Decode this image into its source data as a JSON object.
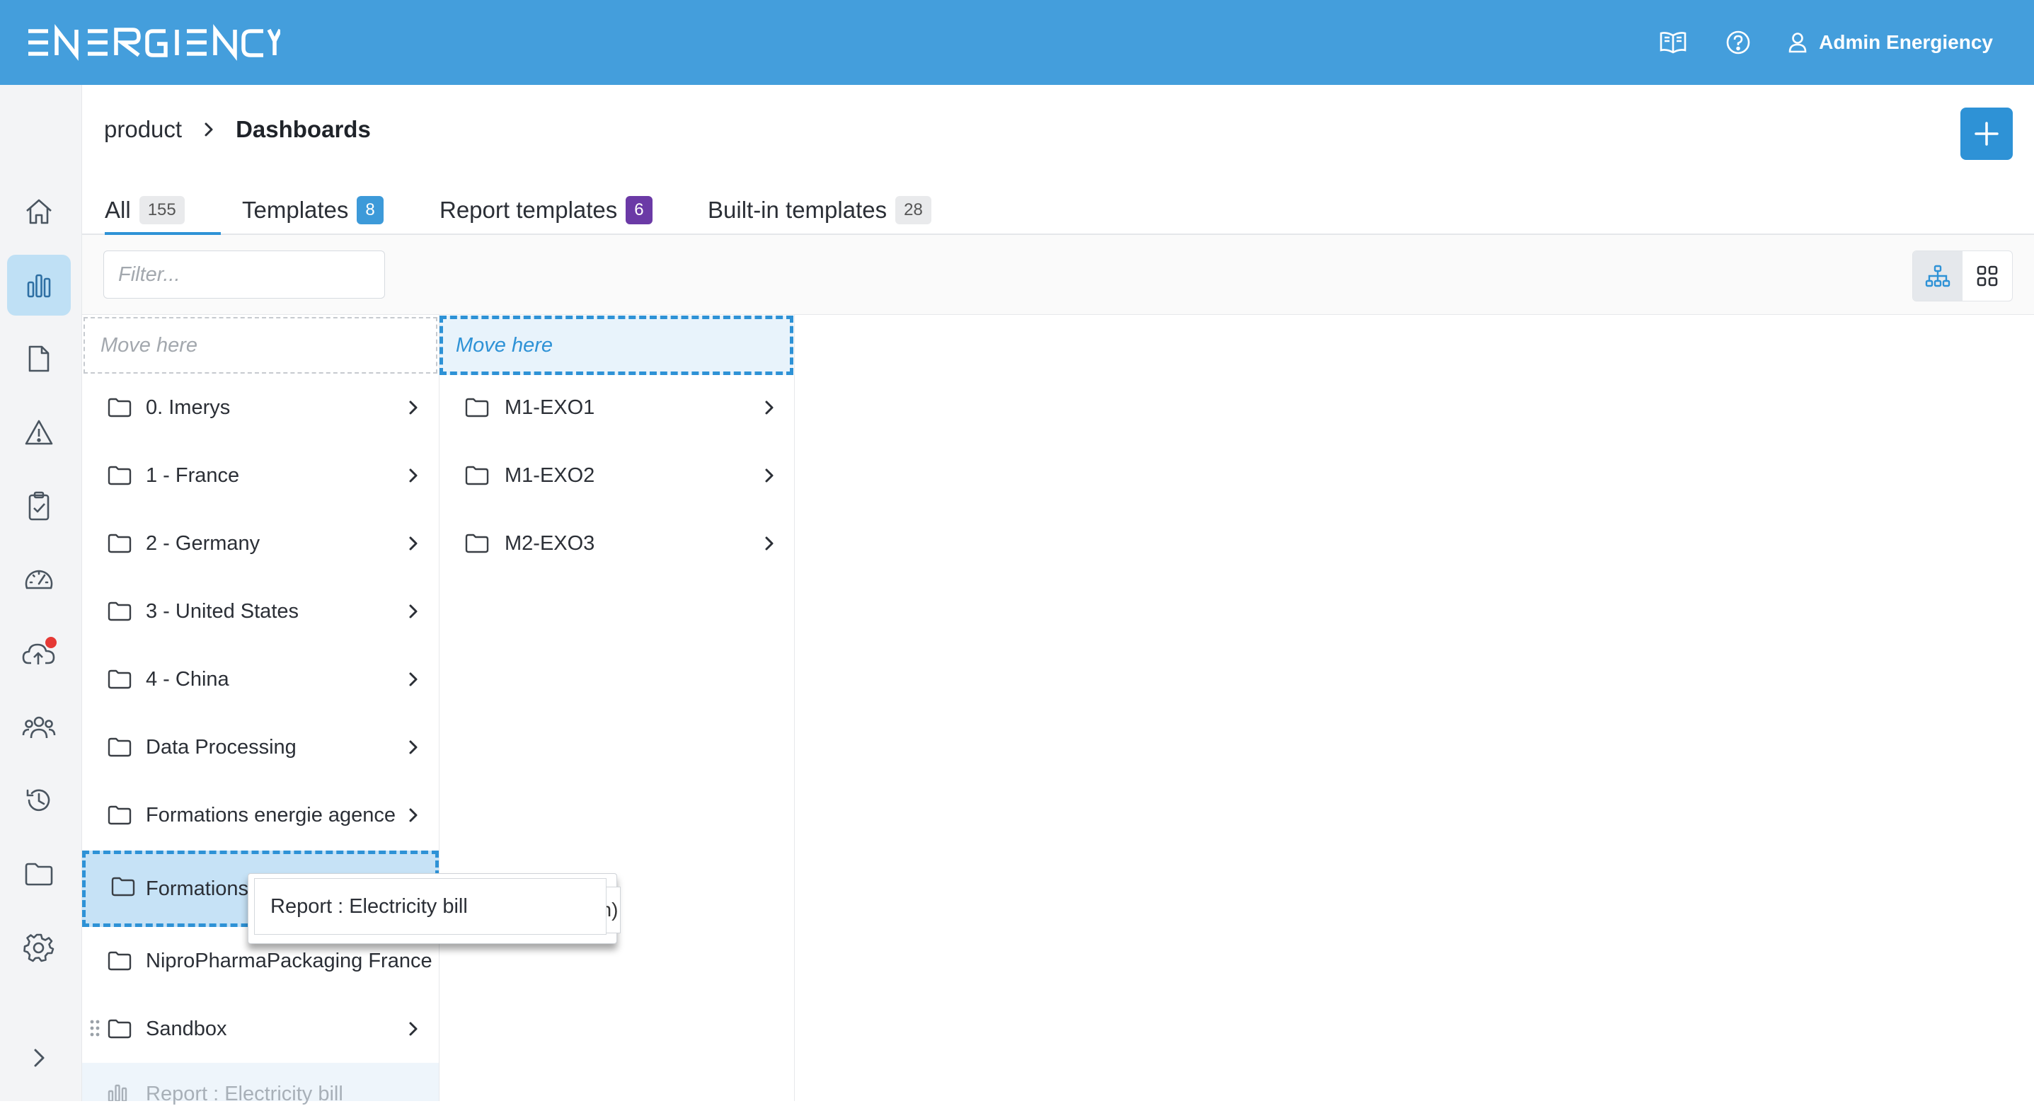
{
  "app": {
    "brand": "ENERGIENCY",
    "user_name": "Admin Energiency",
    "icons": [
      "book-icon",
      "help-icon",
      "user-icon"
    ]
  },
  "sidebar": {
    "items": [
      {
        "name": "home",
        "icon": "home-icon",
        "active": false
      },
      {
        "name": "dashboards",
        "icon": "bar-chart-icon",
        "active": true
      },
      {
        "name": "documents",
        "icon": "document-icon",
        "active": false
      },
      {
        "name": "alerts",
        "icon": "warning-icon",
        "active": false
      },
      {
        "name": "tasks",
        "icon": "clipboard-check-icon",
        "active": false
      },
      {
        "name": "performance",
        "icon": "gauge-icon",
        "active": false
      },
      {
        "name": "upload",
        "icon": "cloud-upload-icon",
        "active": false,
        "notification": true
      },
      {
        "name": "users",
        "icon": "users-icon",
        "active": false
      },
      {
        "name": "history",
        "icon": "history-icon",
        "active": false
      },
      {
        "name": "files",
        "icon": "folder-icon",
        "active": false
      },
      {
        "name": "settings",
        "icon": "gear-icon",
        "active": false
      }
    ],
    "expand_icon": "chevron-right-icon"
  },
  "breadcrumb": {
    "parent": "product",
    "current": "Dashboards"
  },
  "tabs": [
    {
      "label": "All",
      "count": "155",
      "active": true
    },
    {
      "label": "Templates",
      "count": "8"
    },
    {
      "label": "Report templates",
      "count": "6"
    },
    {
      "label": "Built-in templates",
      "count": "28"
    }
  ],
  "filter": {
    "placeholder": "Filter..."
  },
  "columns": {
    "left": {
      "move_here": "Move here",
      "folders": [
        "0. Imerys",
        "1 - France",
        "2 - Germany",
        "3 - United States",
        "4 - China",
        "Data Processing",
        "Formations energie agence",
        "Formations Knowledge",
        "NiproPharmaPackaging France",
        "Sandbox"
      ],
      "dragging_item": "Report : Electricity bill"
    },
    "right": {
      "move_here": "Move here",
      "folders": [
        "M1-EXO1",
        "M1-EXO2",
        "M2-EXO3"
      ]
    }
  },
  "drag_preview": {
    "label": "Report : Electricity bill",
    "behind_text": "n)"
  },
  "colors": {
    "brand": "#449edc",
    "accent": "#2e92d6",
    "purple": "#6b3aa6",
    "active_nav": "#bfe0f5"
  }
}
